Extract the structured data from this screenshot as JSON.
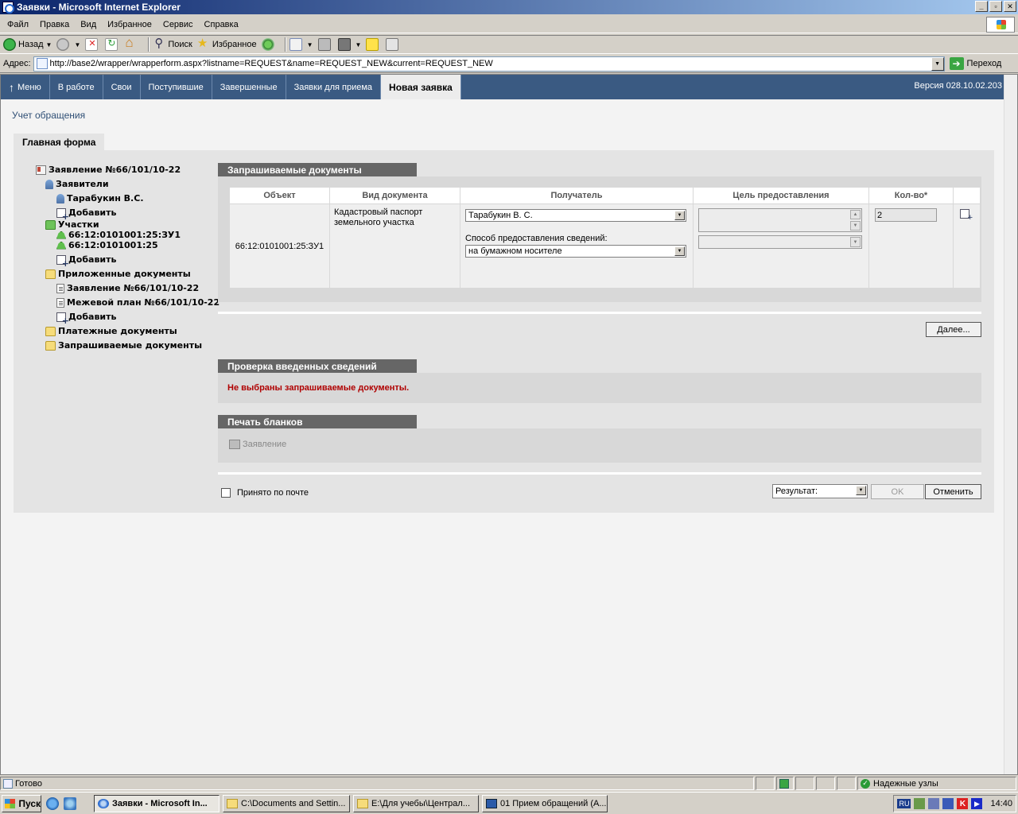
{
  "window": {
    "title": "Заявки - Microsoft Internet Explorer",
    "controls": [
      "_",
      "▫",
      "✕"
    ]
  },
  "menubar": [
    "Файл",
    "Правка",
    "Вид",
    "Избранное",
    "Сервис",
    "Справка"
  ],
  "toolbar": {
    "back": "Назад",
    "search": "Поиск",
    "favorites": "Избранное"
  },
  "address": {
    "label": "Адрес:",
    "url": "http://base2/wrapper/wrapperform.aspx?listname=REQUEST&name=REQUEST_NEW&current=REQUEST_NEW",
    "go": "Переход"
  },
  "nav": {
    "menu": "Меню",
    "tabs": [
      "В работе",
      "Свои",
      "Поступившие",
      "Завершенные",
      "Заявки для приема",
      "Новая заявка"
    ],
    "active_tab": "Новая заявка",
    "version": "Версия 028.10.02.203"
  },
  "page": {
    "title": "Учет обращения",
    "form_tab": "Главная форма"
  },
  "tree": {
    "root": "Заявление №66/101/10-22",
    "applicants": "Заявители",
    "applicant_1": "Тарабукин В.С.",
    "add_applicant": "Добавить",
    "plots": "Участки",
    "plot_1": "66:12:0101001:25:ЗУ1",
    "plot_2": "66:12:0101001:25",
    "add_plot": "Добавить",
    "attached": "Приложенные документы",
    "attached_1": "Заявление №66/101/10-22",
    "attached_2": "Межевой план №66/101/10-22",
    "add_attached": "Добавить",
    "payment": "Платежные документы",
    "requested": "Запрашиваемые документы"
  },
  "requested_docs": {
    "header": "Запрашиваемые документы",
    "columns": [
      "Объект",
      "Вид документа",
      "Получатель",
      "Цель предоставления",
      "Кол-во*"
    ],
    "row": {
      "object": "66:12:0101001:25:ЗУ1",
      "doc_type": "Кадастровый паспорт земельного участка",
      "recipient": "Тарабукин В. С.",
      "method_label": "Способ предоставления сведений:",
      "method": "на бумажном носителе",
      "purpose": "",
      "qty": "2"
    },
    "next_button": "Далее..."
  },
  "check": {
    "header": "Проверка введенных сведений",
    "error": "Не выбраны запрашиваемые документы."
  },
  "print": {
    "header": "Печать бланков",
    "item": "Заявление"
  },
  "footer": {
    "mail_checkbox_label": "Принято по почте",
    "mail_checked": false,
    "result_select": "Результат:",
    "ok": "OK",
    "cancel": "Отменить"
  },
  "colors": {
    "nav_bg": "#3a5a82",
    "section_header": "#666666",
    "error_text": "#b00000",
    "title_text": "#2f4f75"
  },
  "statusbar": {
    "status": "Готово",
    "zone": "Надежные узлы"
  },
  "taskbar": {
    "start": "Пуск",
    "windows": [
      "Заявки - Microsoft In...",
      "C:\\Documents and Settin...",
      "E:\\Для учебы\\Централ...",
      "01 Прием обращений (А..."
    ],
    "lang": "RU",
    "clock": "14:40"
  }
}
